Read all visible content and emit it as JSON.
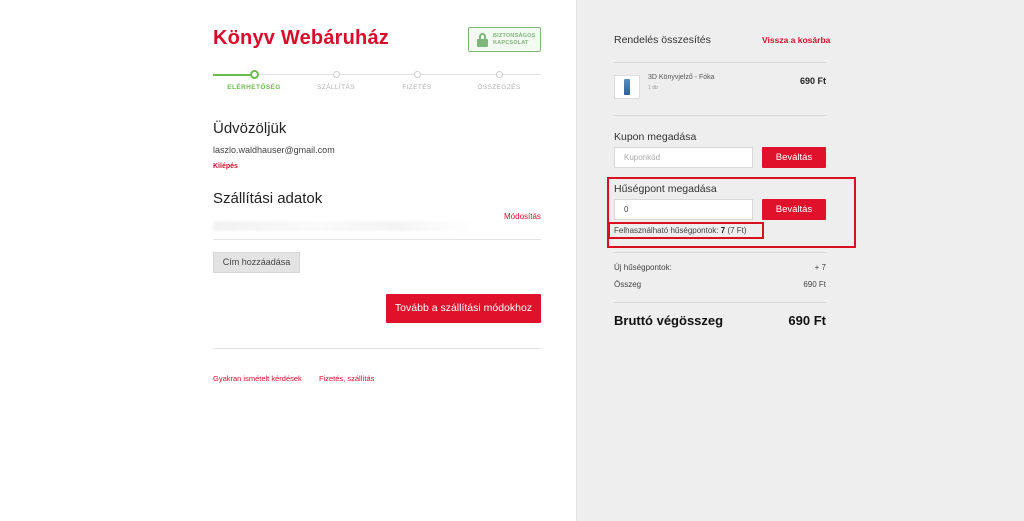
{
  "header": {
    "brand": "Könyv Webáruház",
    "secure_badge": [
      "BIZTONSÁGOS",
      "KAPCSOLAT"
    ]
  },
  "steps": [
    {
      "label": "ELÉRHETŐSÉG",
      "active": true
    },
    {
      "label": "SZÁLLÍTÁS",
      "active": false
    },
    {
      "label": "FIZETÉS",
      "active": false
    },
    {
      "label": "ÖSSZEGZÉS",
      "active": false
    }
  ],
  "welcome": {
    "title": "Üdvözöljük",
    "email": "laszlo.waldhauser@gmail.com",
    "logout": "Kilépés"
  },
  "shipping": {
    "title": "Szállítási adatok",
    "modify": "Módosítás",
    "add_address": "Cím hozzáadása",
    "next_button": "Tovább a szállítási módokhoz"
  },
  "footer": {
    "faq": "Gyakran ismételt kérdések",
    "payment_shipping": "Fizetés, szállítás"
  },
  "summary": {
    "title": "Rendelés összesítés",
    "back": "Vissza a kosárba",
    "item": {
      "name": "3D Könyvjelző - Fóka",
      "qty": "1 db",
      "price": "690 Ft"
    },
    "coupon": {
      "title": "Kupon megadása",
      "placeholder": "Kuponkód",
      "button": "Beváltás"
    },
    "loyalty": {
      "title": "Hűségpont megadása",
      "value": "0",
      "button": "Beváltás",
      "usable_label": "Felhasználható hűségpontok:",
      "usable_points": "7",
      "usable_ft": "(7 Ft)"
    },
    "new_points_label": "Új hűségpontok:",
    "new_points_value": "+ 7",
    "sum_label": "Összeg",
    "sum_value": "690 Ft",
    "gross_label": "Bruttó végösszeg",
    "gross_value": "690 Ft"
  },
  "colors": {
    "accent_red": "#d90d2b",
    "step_green": "#6dbb4e",
    "panel_gray": "#eeeeee"
  }
}
